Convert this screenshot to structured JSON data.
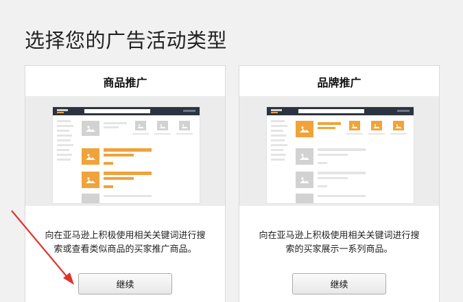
{
  "page": {
    "title": "选择您的广告活动类型"
  },
  "cards": [
    {
      "title": "商品推广",
      "description_line1": "向在亚马逊上积极使用相关关键词进行搜",
      "description_line2": "索或查看类似商品的买家推广商品。",
      "button_label": "继续"
    },
    {
      "title": "品牌推广",
      "description_line1": "向在亚马逊上积极使用相关关键词进行搜",
      "description_line2": "索的买家展示一系列商品。",
      "button_label": "继续"
    }
  ],
  "colors": {
    "accent_orange": "#f0a33a",
    "arrow_red": "#e0322c",
    "mock_header": "#2b3440"
  }
}
